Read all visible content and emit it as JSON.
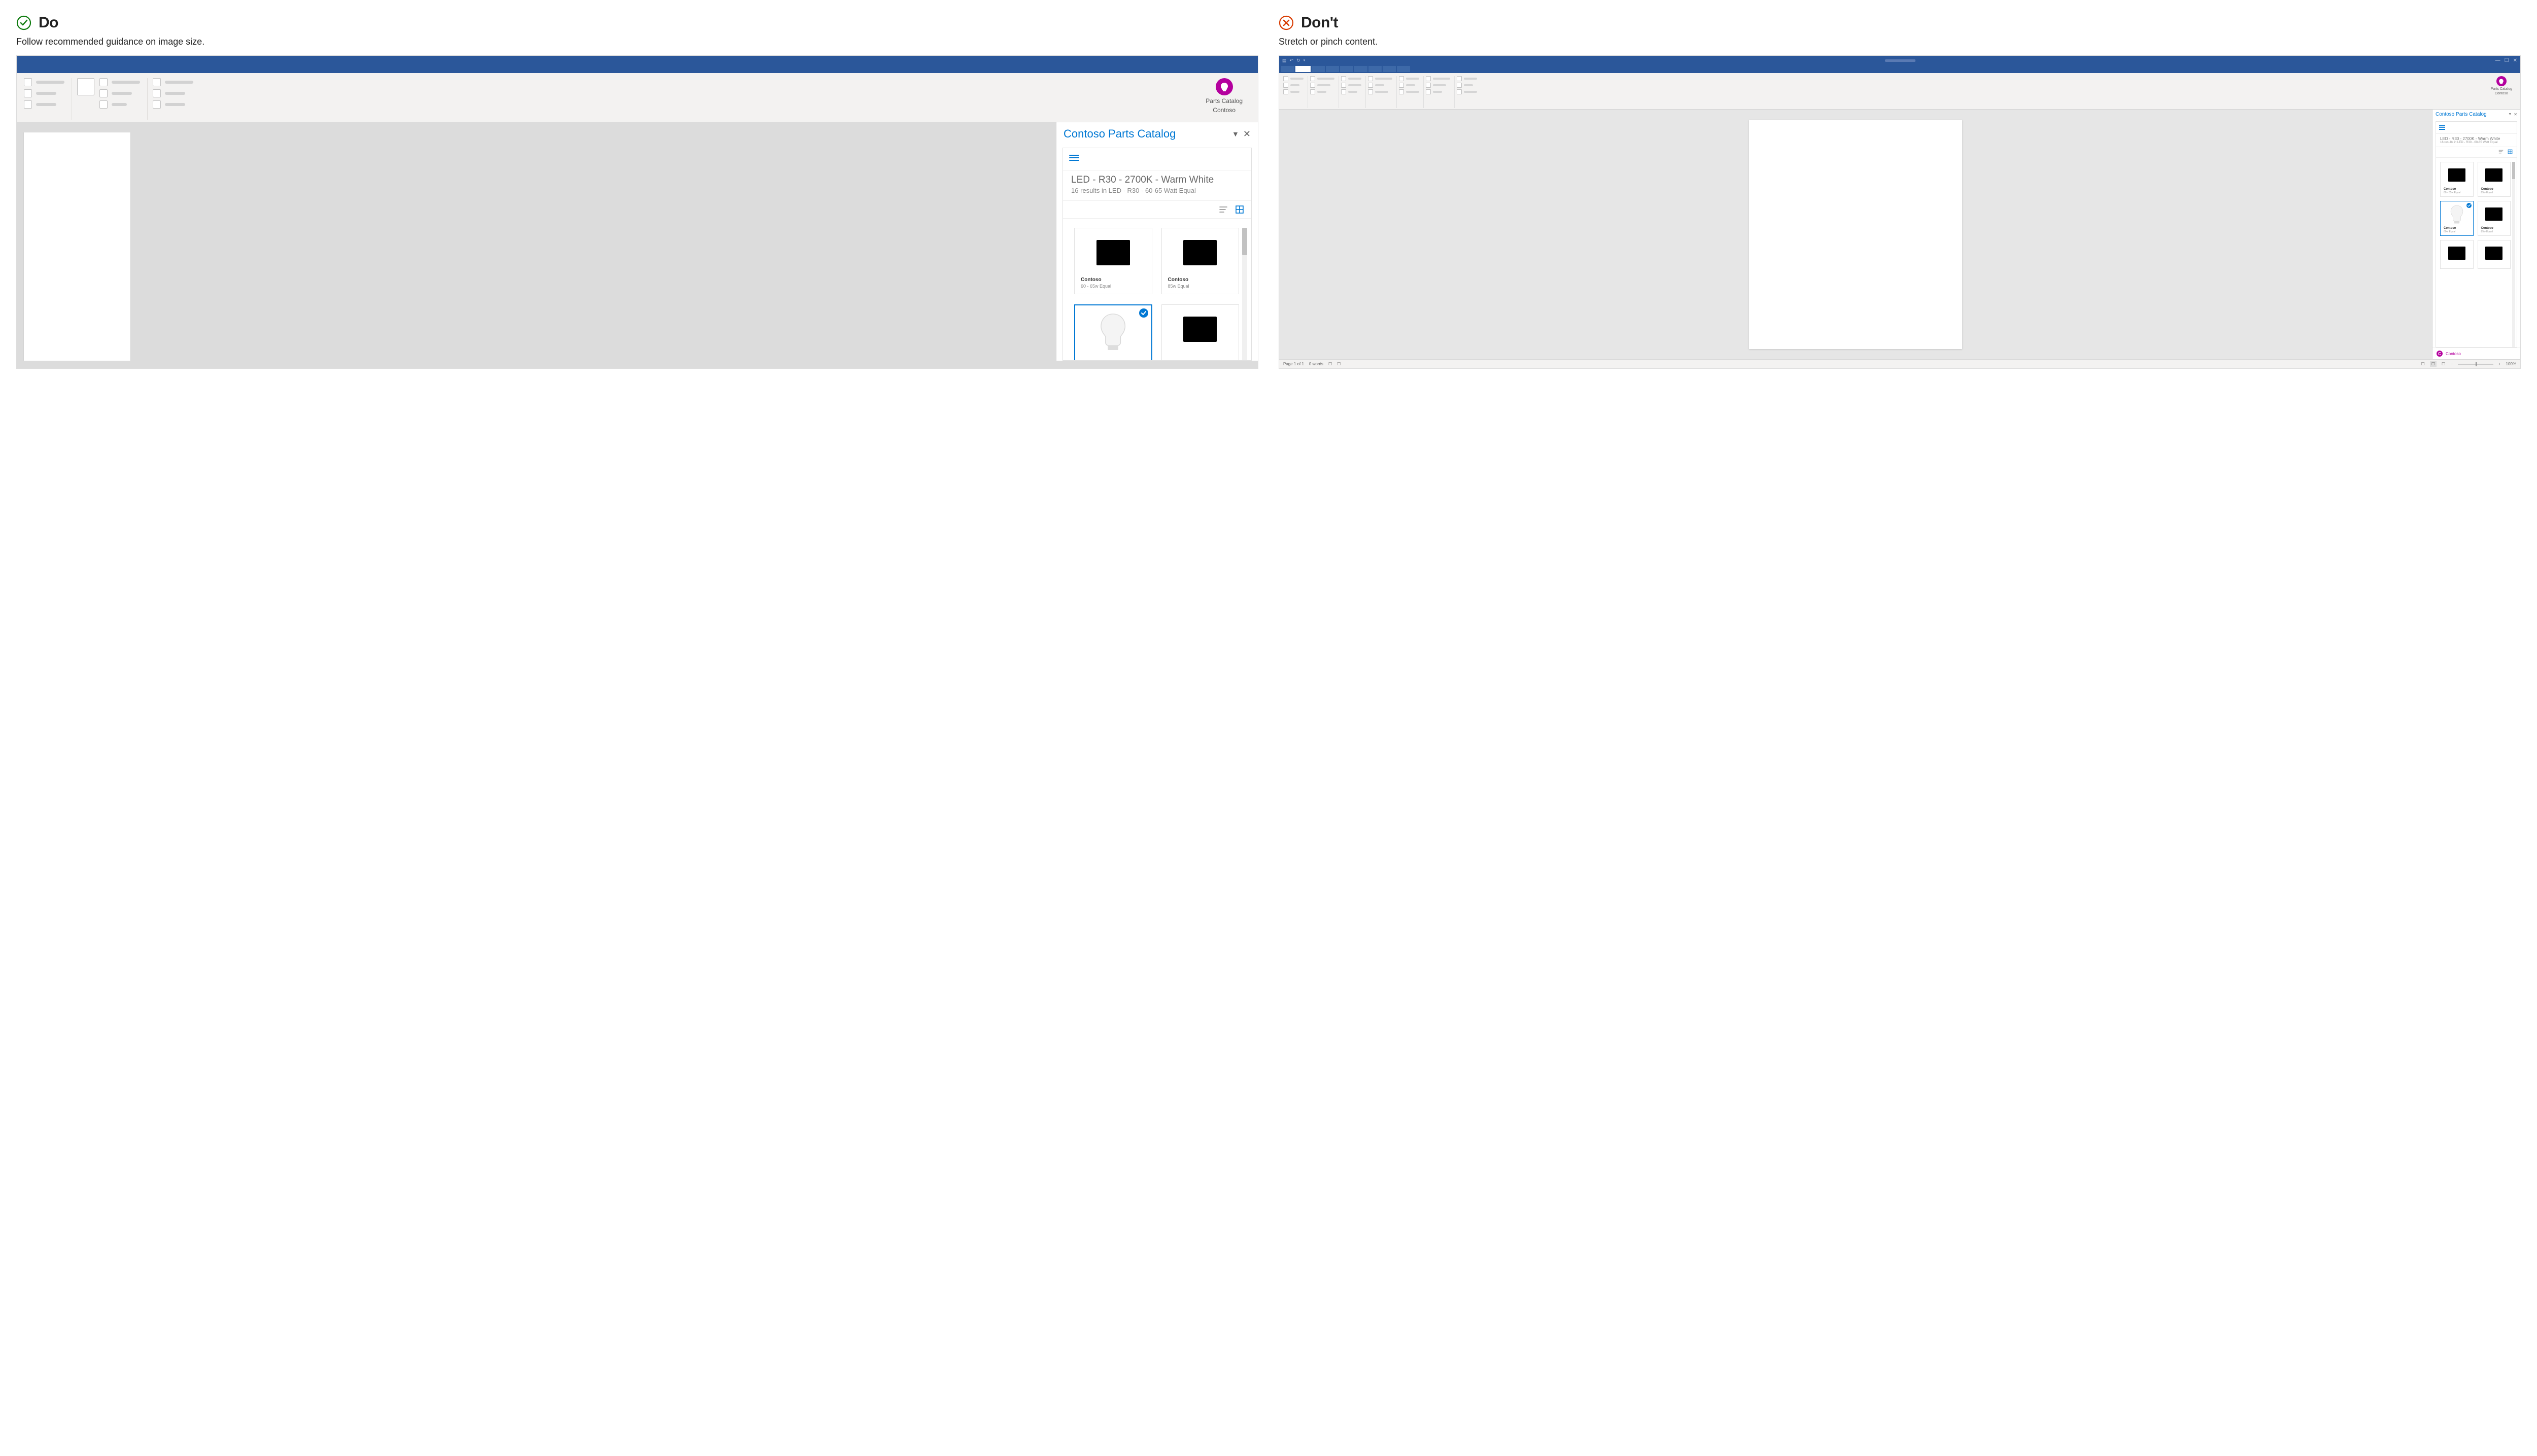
{
  "do": {
    "heading": "Do",
    "sub": "Follow recommended guidance on image size.",
    "addin": {
      "line1": "Parts Catalog",
      "line2": "Contoso"
    },
    "taskpane": {
      "title": "Contoso Parts Catalog",
      "breadcrumb1": "LED - R30 - 2700K - Warm White",
      "breadcrumb2": "16 results in LED - R30 - 60-65 Watt Equal",
      "tiles": [
        {
          "vendor": "Contoso",
          "spec": "60 - 65w Equal",
          "selected": false,
          "kind": "placeholder"
        },
        {
          "vendor": "Contoso",
          "spec": "85w Equal",
          "selected": false,
          "kind": "placeholder"
        },
        {
          "vendor": "",
          "spec": "",
          "selected": true,
          "kind": "bulb"
        },
        {
          "vendor": "",
          "spec": "",
          "selected": false,
          "kind": "placeholder"
        }
      ]
    }
  },
  "dont": {
    "heading": "Don't",
    "sub": "Stretch or pinch content.",
    "addin": {
      "line1": "Parts Catalog",
      "line2": "Contoso"
    },
    "status": {
      "pages": "Page 1 of 1",
      "words": "0 words",
      "zoom": "100%"
    },
    "taskpane": {
      "title": "Contoso Parts Catalog",
      "breadcrumb1": "LED - R30 - 2700K - Warm White",
      "breadcrumb2": "16 results in LED - R30 - 60-65 Watt Equal",
      "brand": "Contoso",
      "tiles": [
        {
          "vendor": "Contoso",
          "spec": "60 - 65w Equal",
          "selected": false,
          "kind": "placeholder"
        },
        {
          "vendor": "Contoso",
          "spec": "85w Equal",
          "selected": false,
          "kind": "placeholder"
        },
        {
          "vendor": "Contoso",
          "spec": "60w Equal",
          "selected": true,
          "kind": "bulb"
        },
        {
          "vendor": "Contoso",
          "spec": "85w Equal",
          "selected": false,
          "kind": "placeholder"
        },
        {
          "vendor": "",
          "spec": "",
          "selected": false,
          "kind": "placeholder"
        },
        {
          "vendor": "",
          "spec": "",
          "selected": false,
          "kind": "placeholder"
        }
      ]
    }
  }
}
